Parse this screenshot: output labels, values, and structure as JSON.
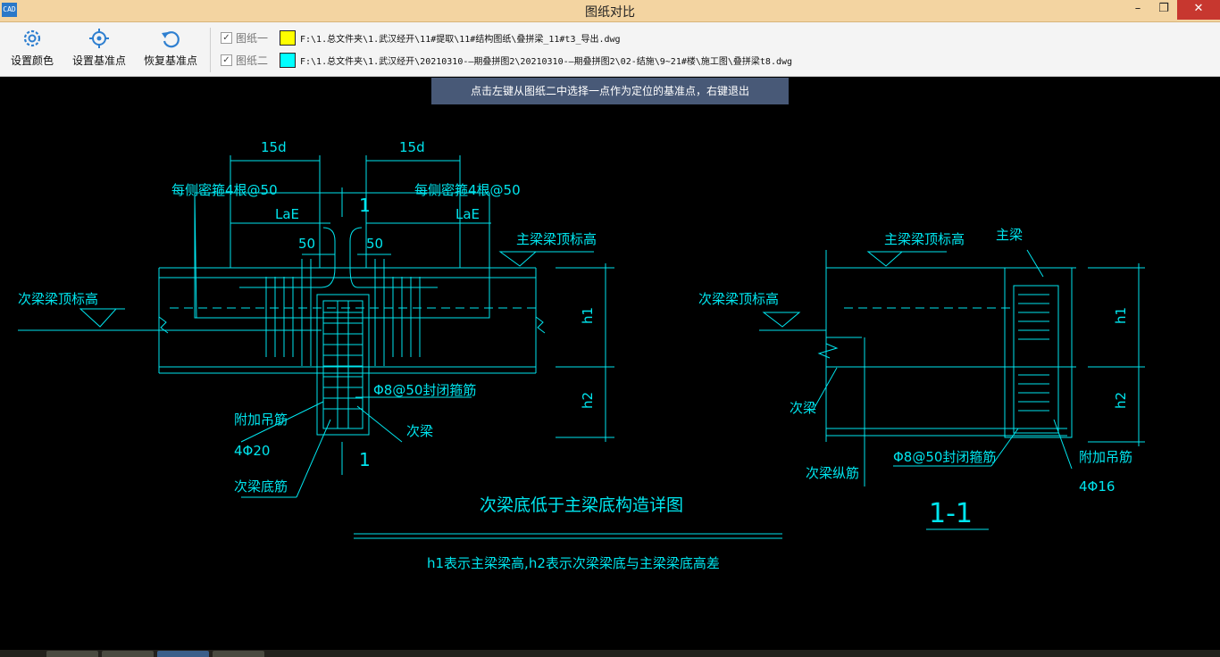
{
  "window": {
    "title": "图纸对比",
    "icon_text": "CAD",
    "controls": {
      "minimize": "–",
      "maximize": "❐",
      "close": "✕"
    }
  },
  "toolbar": {
    "buttons": [
      {
        "label": "设置颜色",
        "icon": "gear-icon"
      },
      {
        "label": "设置基准点",
        "icon": "crosshair-icon"
      },
      {
        "label": "恢复基准点",
        "icon": "undo-icon"
      }
    ],
    "drawings": [
      {
        "label": "图纸一",
        "checked": true,
        "color": "#ffff00",
        "path": "F:\\1.总文件夹\\1.武汉经开\\11#提取\\11#结构图纸\\叠拼梁_11#t3_导出.dwg"
      },
      {
        "label": "图纸二",
        "checked": true,
        "color": "#00ffff",
        "path": "F:\\1.总文件夹\\1.武汉经开\\20210310-—期叠拼图2\\20210310-—期叠拼图2\\02-结施\\9~21#楼\\施工图\\叠拼梁t8.dwg"
      }
    ]
  },
  "hint": "点击左键从图纸二中选择一点作为定位的基准点，右键退出",
  "drawing": {
    "color": "#00e5ee",
    "left": {
      "dim_15d_left": "15d",
      "dim_15d_right": "15d",
      "stirrups_left": "每侧密箍4根@50",
      "stirrups_right": "每侧密箍4根@50",
      "lae_left": "LaE",
      "lae_right": "LaE",
      "d50_left": "50",
      "d50_right": "50",
      "section_mark_top": "1",
      "section_mark_bottom": "1",
      "main_top_elev": "主梁梁顶标高",
      "sec_top_elev": "次梁梁顶标高",
      "h1": "h1",
      "h2": "h2",
      "closed_stirrup": "Φ8@50封闭箍筋",
      "hanger": "附加吊筋",
      "hanger_spec": "4Φ20",
      "secondary_beam": "次梁",
      "sec_bottom_bar": "次梁底筋"
    },
    "right": {
      "main_top_elev": "主梁梁顶标高",
      "main_beam": "主梁",
      "sec_top_elev": "次梁梁顶标高",
      "h1": "h1",
      "h2": "h2",
      "secondary_beam": "次梁",
      "sec_long_bar": "次梁纵筋",
      "closed_stirrup": "Φ8@50封闭箍筋",
      "hanger": "附加吊筋",
      "hanger_spec": "4Φ16",
      "section_label": "1-1"
    },
    "detail_title": "次梁底低于主梁底构造详图",
    "note": "h1表示主梁梁高,h2表示次梁梁底与主梁梁底高差"
  }
}
